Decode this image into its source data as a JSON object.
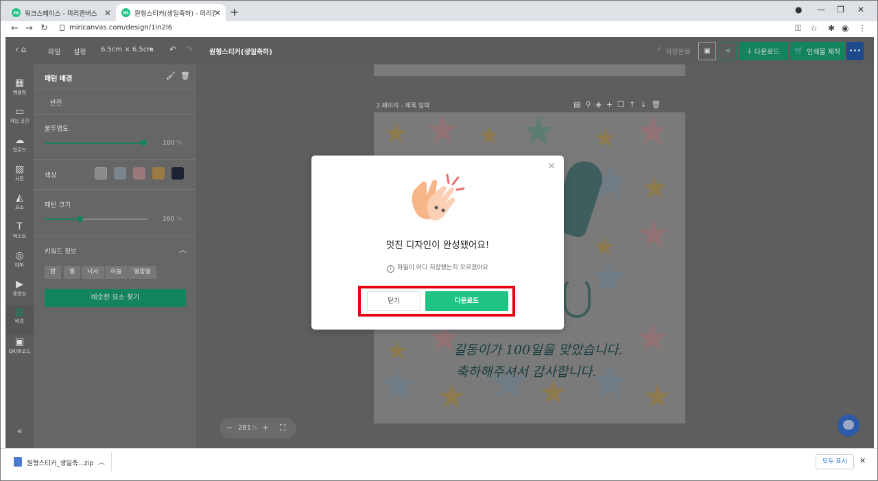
{
  "browser": {
    "tabs": [
      {
        "title": "워크스페이스 - 미리캔버스"
      },
      {
        "title": "원형스티커(생일축하) - 미리캔버스"
      }
    ],
    "url": "miricanvas.com/design/1in2l6"
  },
  "header": {
    "menu_file": "파일",
    "menu_settings": "설정",
    "size": "6.5cm × 6.5cm",
    "doc_title": "원형스티커(생일축하)",
    "save_status": "저장완료",
    "download": "다운로드",
    "print": "인쇄물 제작"
  },
  "sidebar": {
    "items": [
      {
        "label": "템플릿",
        "icon": "template-icon"
      },
      {
        "label": "작업 공간",
        "icon": "workspace-icon"
      },
      {
        "label": "업로드",
        "icon": "upload-icon"
      },
      {
        "label": "사진",
        "icon": "photo-icon"
      },
      {
        "label": "요소",
        "icon": "elements-icon"
      },
      {
        "label": "텍스트",
        "icon": "text-icon"
      },
      {
        "label": "테마",
        "icon": "theme-icon"
      },
      {
        "label": "동영상",
        "icon": "video-icon"
      },
      {
        "label": "배경",
        "icon": "background-icon"
      },
      {
        "label": "QR/바코드",
        "icon": "qr-icon"
      }
    ]
  },
  "panel": {
    "title": "패턴 배경",
    "invert": "반전",
    "opacity_label": "불투명도",
    "opacity_value": "100",
    "percent": "%",
    "color_label": "색상",
    "colors": [
      "#ffffff",
      "#a9bac6",
      "#e79ca2",
      "#e6a53c",
      "#1d2b49"
    ],
    "size_label": "패턴 크기",
    "size_value": "100",
    "keyword_label": "키워드 정보",
    "keywords": [
      "밤",
      "별",
      "낙서",
      "하늘",
      "별똥별"
    ],
    "similar_button": "비슷한 요소 찾기"
  },
  "canvas": {
    "page_label": "3 페이지 - 제목 입력",
    "line1": "길동이가 100일을 맞았습니다.",
    "line2": "축하해주셔서 감사합니다.",
    "zoom": "281",
    "zoom_unit": "%"
  },
  "modal": {
    "title": "멋진 디자인이 완성됐어요!",
    "help_text": "파일이 어디 저장됐는지 모르겠어요",
    "close_button": "닫기",
    "download_button": "다운로드",
    "highlight_color": "#e60012"
  },
  "download_bar": {
    "filename": "원형스티커_생일축...zip",
    "show_all": "모두 표시"
  }
}
